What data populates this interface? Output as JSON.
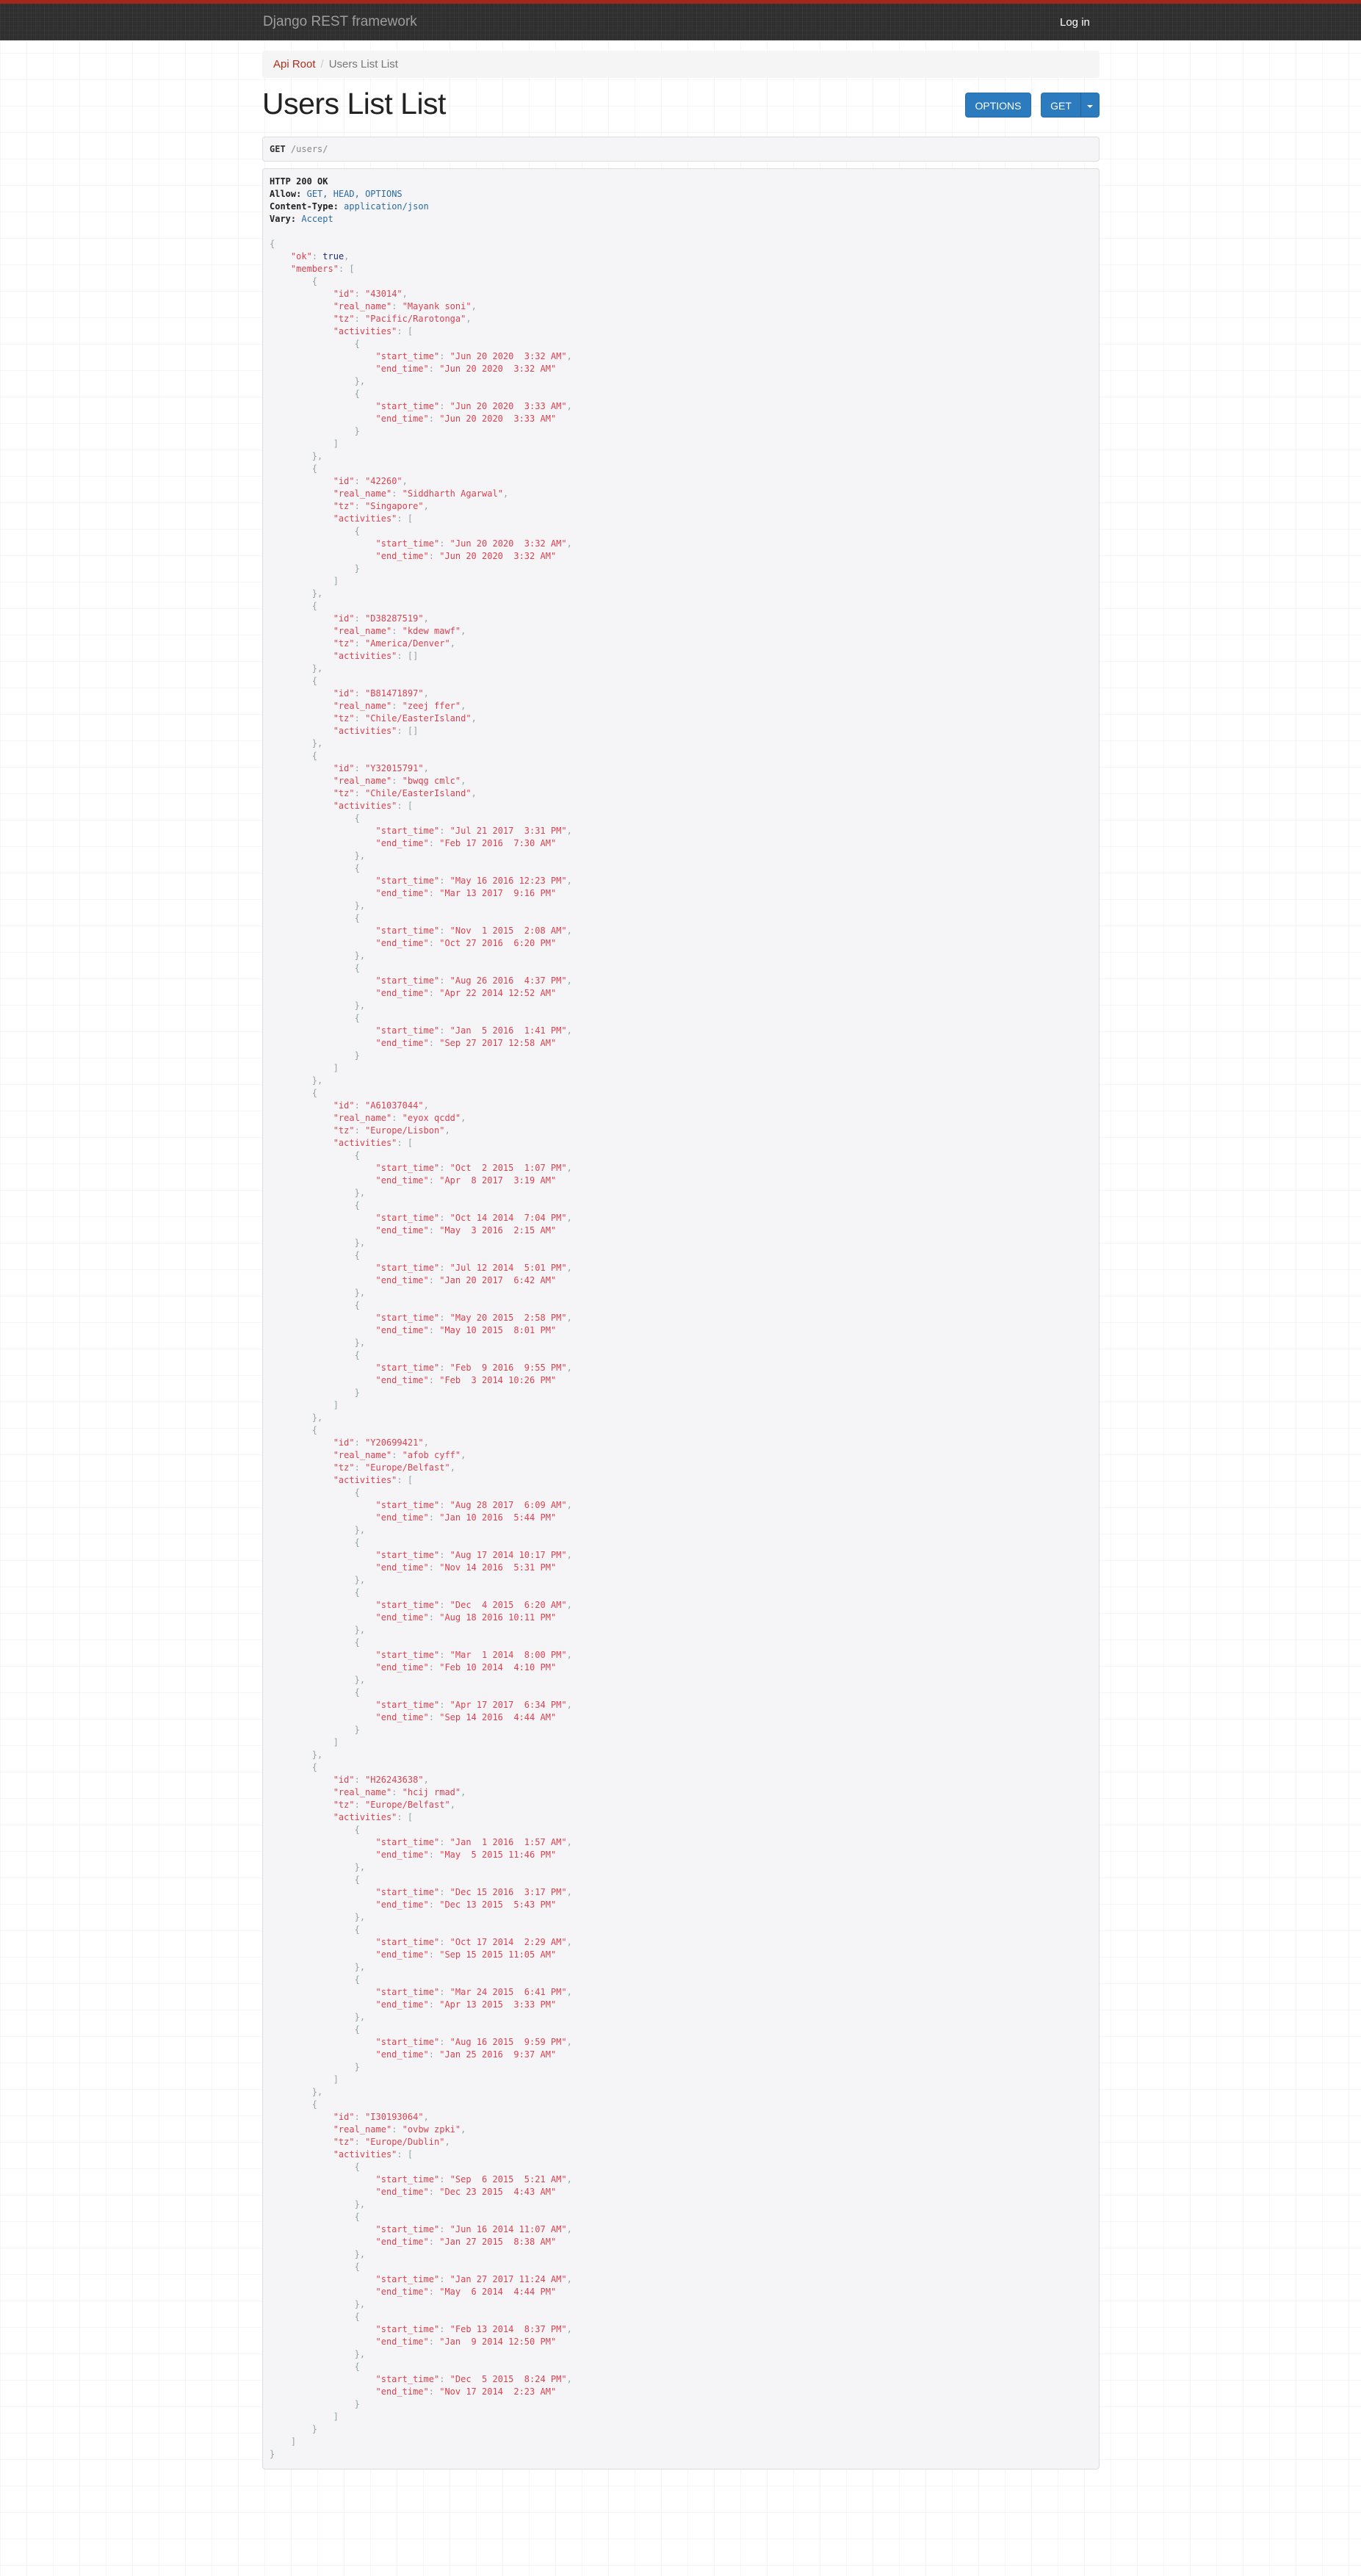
{
  "navbar": {
    "brand": "Django REST framework",
    "login": "Log in"
  },
  "breadcrumb": {
    "root": "Api Root",
    "separator": "/",
    "current": "Users List List"
  },
  "page_title": "Users List List",
  "buttons": {
    "options": "OPTIONS",
    "get": "GET"
  },
  "request": {
    "method": "GET",
    "path": "/users/"
  },
  "colors": {
    "accent": "#2d7bbf",
    "navbar_border": "#a3261a",
    "json_string": "#dc4150"
  },
  "response": {
    "status": "HTTP 200 OK",
    "headers": [
      {
        "name": "Allow",
        "value": "GET, HEAD, OPTIONS"
      },
      {
        "name": "Content-Type",
        "value": "application/json"
      },
      {
        "name": "Vary",
        "value": "Accept"
      }
    ],
    "body": {
      "ok": true,
      "members": [
        {
          "id": "43014",
          "real_name": "Mayank soni",
          "tz": "Pacific/Rarotonga",
          "activities": [
            {
              "start_time": "Jun 20 2020  3:32 AM",
              "end_time": "Jun 20 2020  3:32 AM"
            },
            {
              "start_time": "Jun 20 2020  3:33 AM",
              "end_time": "Jun 20 2020  3:33 AM"
            }
          ]
        },
        {
          "id": "42260",
          "real_name": "Siddharth Agarwal",
          "tz": "Singapore",
          "activities": [
            {
              "start_time": "Jun 20 2020  3:32 AM",
              "end_time": "Jun 20 2020  3:32 AM"
            }
          ]
        },
        {
          "id": "D38287519",
          "real_name": "kdew mawf",
          "tz": "America/Denver",
          "activities": []
        },
        {
          "id": "B81471897",
          "real_name": "zeej ffer",
          "tz": "Chile/EasterIsland",
          "activities": []
        },
        {
          "id": "Y32015791",
          "real_name": "bwqg cmlc",
          "tz": "Chile/EasterIsland",
          "activities": [
            {
              "start_time": "Jul 21 2017  3:31 PM",
              "end_time": "Feb 17 2016  7:30 AM"
            },
            {
              "start_time": "May 16 2016 12:23 PM",
              "end_time": "Mar 13 2017  9:16 PM"
            },
            {
              "start_time": "Nov  1 2015  2:08 AM",
              "end_time": "Oct 27 2016  6:20 PM"
            },
            {
              "start_time": "Aug 26 2016  4:37 PM",
              "end_time": "Apr 22 2014 12:52 AM"
            },
            {
              "start_time": "Jan  5 2016  1:41 PM",
              "end_time": "Sep 27 2017 12:58 AM"
            }
          ]
        },
        {
          "id": "A61037044",
          "real_name": "eyox qcdd",
          "tz": "Europe/Lisbon",
          "activities": [
            {
              "start_time": "Oct  2 2015  1:07 PM",
              "end_time": "Apr  8 2017  3:19 AM"
            },
            {
              "start_time": "Oct 14 2014  7:04 PM",
              "end_time": "May  3 2016  2:15 AM"
            },
            {
              "start_time": "Jul 12 2014  5:01 PM",
              "end_time": "Jan 20 2017  6:42 AM"
            },
            {
              "start_time": "May 20 2015  2:58 PM",
              "end_time": "May 10 2015  8:01 PM"
            },
            {
              "start_time": "Feb  9 2016  9:55 PM",
              "end_time": "Feb  3 2014 10:26 PM"
            }
          ]
        },
        {
          "id": "Y20699421",
          "real_name": "afob cyff",
          "tz": "Europe/Belfast",
          "activities": [
            {
              "start_time": "Aug 28 2017  6:09 AM",
              "end_time": "Jan 10 2016  5:44 PM"
            },
            {
              "start_time": "Aug 17 2014 10:17 PM",
              "end_time": "Nov 14 2016  5:31 PM"
            },
            {
              "start_time": "Dec  4 2015  6:20 AM",
              "end_time": "Aug 18 2016 10:11 PM"
            },
            {
              "start_time": "Mar  1 2014  8:00 PM",
              "end_time": "Feb 10 2014  4:10 PM"
            },
            {
              "start_time": "Apr 17 2017  6:34 PM",
              "end_time": "Sep 14 2016  4:44 AM"
            }
          ]
        },
        {
          "id": "H26243638",
          "real_name": "hcij rmad",
          "tz": "Europe/Belfast",
          "activities": [
            {
              "start_time": "Jan  1 2016  1:57 AM",
              "end_time": "May  5 2015 11:46 PM"
            },
            {
              "start_time": "Dec 15 2016  3:17 PM",
              "end_time": "Dec 13 2015  5:43 PM"
            },
            {
              "start_time": "Oct 17 2014  2:29 AM",
              "end_time": "Sep 15 2015 11:05 AM"
            },
            {
              "start_time": "Mar 24 2015  6:41 PM",
              "end_time": "Apr 13 2015  3:33 PM"
            },
            {
              "start_time": "Aug 16 2015  9:59 PM",
              "end_time": "Jan 25 2016  9:37 AM"
            }
          ]
        },
        {
          "id": "I30193064",
          "real_name": "ovbw zpki",
          "tz": "Europe/Dublin",
          "activities": [
            {
              "start_time": "Sep  6 2015  5:21 AM",
              "end_time": "Dec 23 2015  4:43 AM"
            },
            {
              "start_time": "Jun 16 2014 11:07 AM",
              "end_time": "Jan 27 2015  8:38 AM"
            },
            {
              "start_time": "Jan 27 2017 11:24 AM",
              "end_time": "May  6 2014  4:44 PM"
            },
            {
              "start_time": "Feb 13 2014  8:37 PM",
              "end_time": "Jan  9 2014 12:50 PM"
            },
            {
              "start_time": "Dec  5 2015  8:24 PM",
              "end_time": "Nov 17 2014  2:23 AM"
            }
          ]
        }
      ]
    }
  }
}
